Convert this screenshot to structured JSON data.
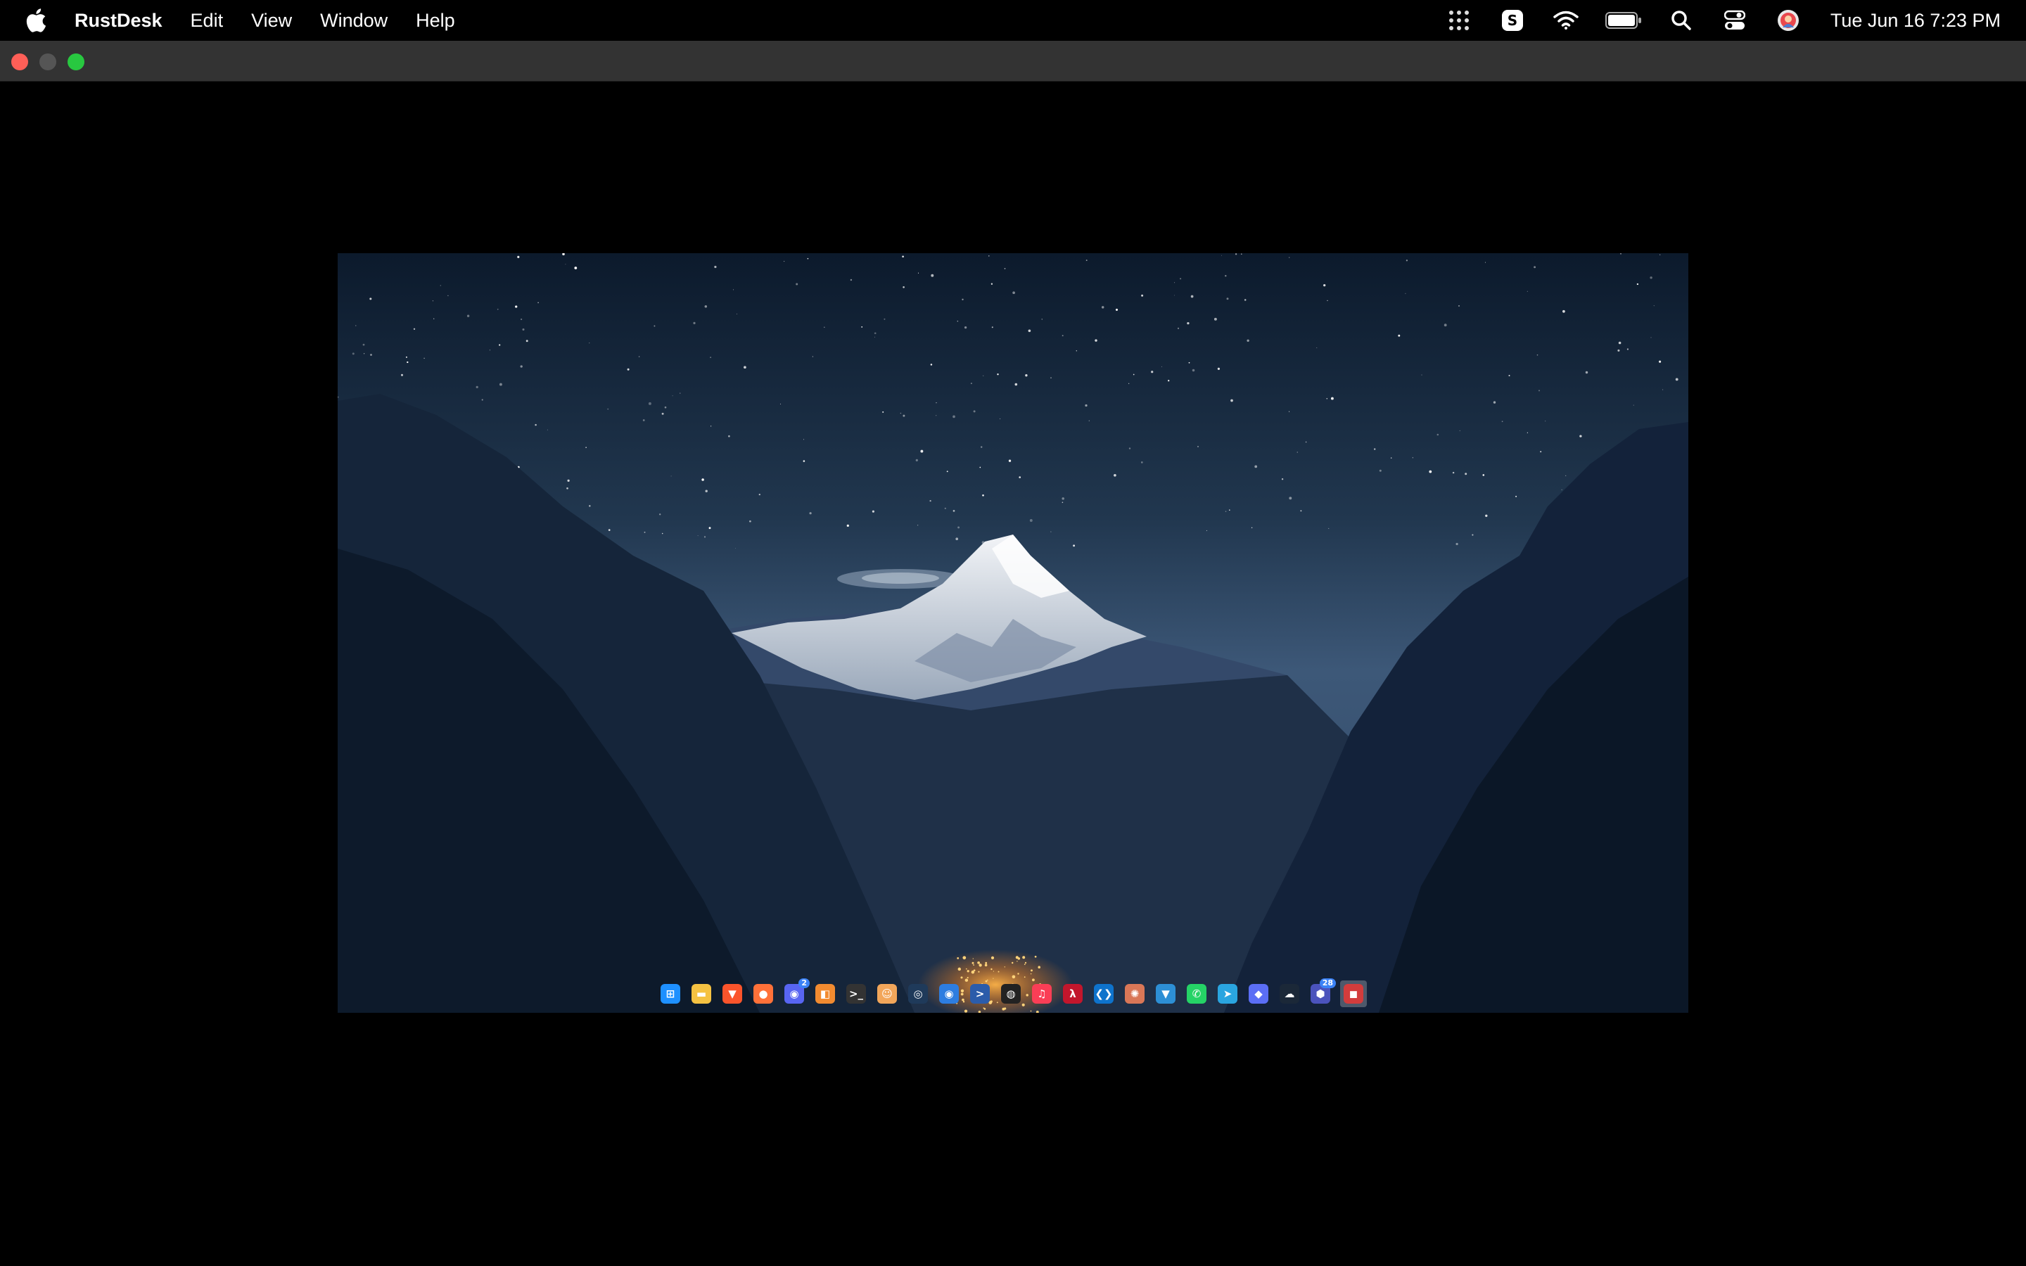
{
  "menubar": {
    "app_name": "RustDesk",
    "menus": [
      "Edit",
      "View",
      "Window",
      "Help"
    ],
    "clock": "Tue Jun 16  7:23 PM",
    "status_icons": [
      "grid-dots-icon",
      "skype-icon",
      "wifi-icon",
      "battery-icon",
      "search-icon",
      "control-center-icon",
      "user-avatar-icon"
    ]
  },
  "window": {
    "buttons": [
      "close",
      "minimize",
      "maximize"
    ]
  },
  "remote_desktop": {
    "wallpaper": "starry night mountain valley",
    "taskbar_icons": [
      {
        "name": "start-icon",
        "color": "#1e90ff",
        "glyph": "⊞"
      },
      {
        "name": "file-explorer-icon",
        "color": "#f5c242",
        "glyph": "▬"
      },
      {
        "name": "brave-icon",
        "color": "#fb542b",
        "glyph": "▼"
      },
      {
        "name": "firefox-icon",
        "color": "#ff7139",
        "glyph": "●"
      },
      {
        "name": "discord-icon",
        "color": "#5865f2",
        "glyph": "◉",
        "badge": "2"
      },
      {
        "name": "remote-app-icon",
        "color": "#f28b30",
        "glyph": "◧"
      },
      {
        "name": "terminal-icon",
        "color": "#333333",
        "glyph": ">_"
      },
      {
        "name": "smiley-app-icon",
        "color": "#f2a65a",
        "glyph": "☺"
      },
      {
        "name": "system-monitor-icon",
        "color": "#1f3a5a",
        "glyph": "◎"
      },
      {
        "name": "browser-icon",
        "color": "#2d7de0",
        "glyph": "◉"
      },
      {
        "name": "powershell-icon",
        "color": "#2b5caa",
        "glyph": ">"
      },
      {
        "name": "github-icon",
        "color": "#222222",
        "glyph": "◍"
      },
      {
        "name": "music-icon",
        "color": "#fa3e56",
        "glyph": "♫"
      },
      {
        "name": "acrobat-icon",
        "color": "#c2162c",
        "glyph": "λ"
      },
      {
        "name": "vscode-icon",
        "color": "#0e73cc",
        "glyph": "❮❯"
      },
      {
        "name": "claude-icon",
        "color": "#d97757",
        "glyph": "✺"
      },
      {
        "name": "vpn-icon",
        "color": "#2d8fd5",
        "glyph": "▼"
      },
      {
        "name": "whatsapp-icon",
        "color": "#25d366",
        "glyph": "✆"
      },
      {
        "name": "telegram-icon",
        "color": "#2aa5e0",
        "glyph": "➤"
      },
      {
        "name": "gem-icon",
        "color": "#5b6ef5",
        "glyph": "◆"
      },
      {
        "name": "steam-icon",
        "color": "#1b2838",
        "glyph": "☁"
      },
      {
        "name": "teams-icon",
        "color": "#4b53bc",
        "glyph": "⬢",
        "badge": "28"
      },
      {
        "name": "active-app-icon",
        "color": "#d33c3c",
        "glyph": "◼",
        "active": true
      }
    ]
  }
}
